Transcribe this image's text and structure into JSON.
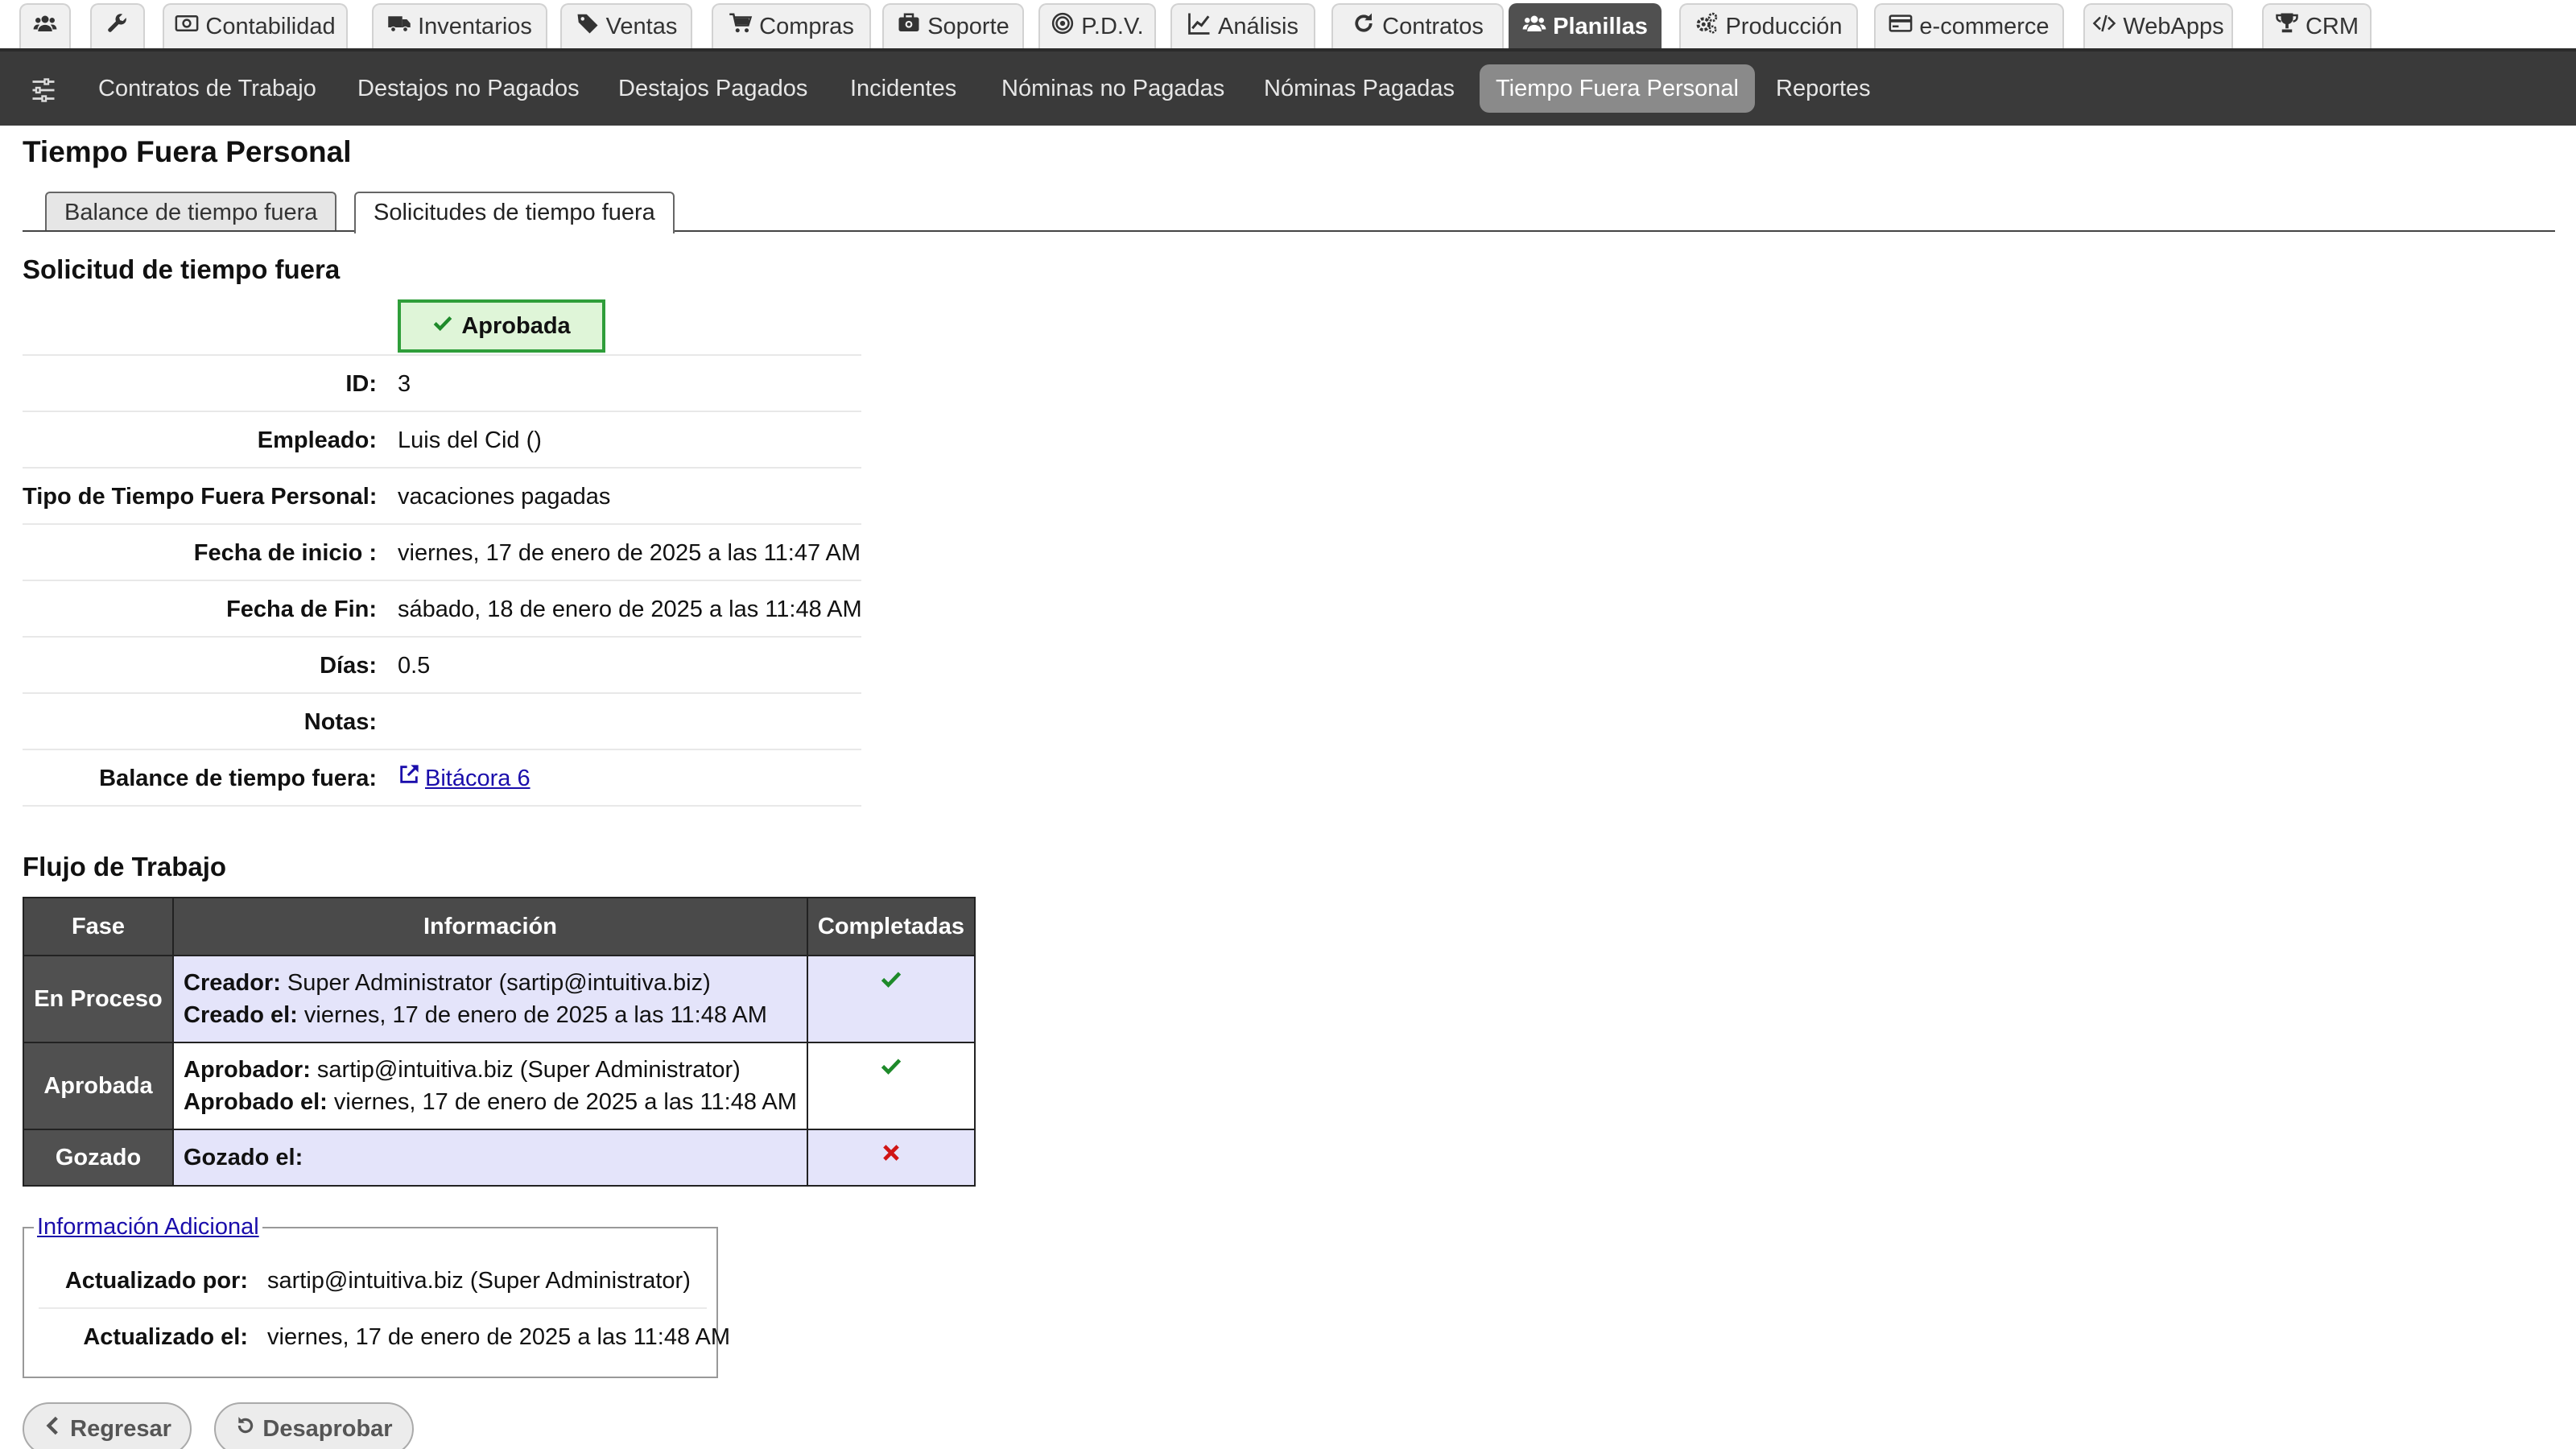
{
  "modules": [
    {
      "label": "",
      "icon": "users-icon"
    },
    {
      "label": "",
      "icon": "wrench-icon"
    },
    {
      "label": "Contabilidad",
      "icon": "money-icon"
    },
    {
      "label": "Inventarios",
      "icon": "truck-icon"
    },
    {
      "label": "Ventas",
      "icon": "tags-icon"
    },
    {
      "label": "Compras",
      "icon": "cart-icon"
    },
    {
      "label": "Soporte",
      "icon": "support-icon"
    },
    {
      "label": "P.D.V.",
      "icon": "target-icon"
    },
    {
      "label": "Análisis",
      "icon": "chart-icon"
    },
    {
      "label": "Contratos",
      "icon": "refresh-icon"
    },
    {
      "label": "Planillas",
      "icon": "users-icon",
      "active": true
    },
    {
      "label": "Producción",
      "icon": "cogs-icon"
    },
    {
      "label": "e-commerce",
      "icon": "card-icon"
    },
    {
      "label": "WebApps",
      "icon": "code-icon"
    },
    {
      "label": "CRM",
      "icon": "trophy-icon"
    }
  ],
  "subnav": [
    {
      "label": "Contratos de Trabajo"
    },
    {
      "label": "Destajos no Pagados"
    },
    {
      "label": "Destajos Pagados"
    },
    {
      "label": "Incidentes"
    },
    {
      "label": "Nóminas no Pagadas"
    },
    {
      "label": "Nóminas Pagadas"
    },
    {
      "label": "Tiempo Fuera Personal",
      "active": true
    },
    {
      "label": "Reportes"
    }
  ],
  "page": {
    "title": "Tiempo Fuera Personal",
    "tabs": [
      "Balance de tiempo fuera",
      "Solicitudes de tiempo fuera"
    ],
    "section_title": "Solicitud de tiempo fuera"
  },
  "request": {
    "status": "Aprobada",
    "fields": [
      {
        "label": "ID:",
        "value": "3"
      },
      {
        "label": "Empleado:",
        "value": "Luis del Cid ()"
      },
      {
        "label": "Tipo de Tiempo Fuera Personal:",
        "value": "vacaciones pagadas"
      },
      {
        "label": "Fecha de inicio :",
        "value": "viernes, 17 de enero de 2025 a las 11:47 AM"
      },
      {
        "label": "Fecha de Fin:",
        "value": "sábado, 18 de enero de 2025 a las 11:48 AM"
      },
      {
        "label": "Días:",
        "value": "0.5"
      },
      {
        "label": "Notas:",
        "value": ""
      },
      {
        "label": "Balance de tiempo fuera:",
        "value": " Bitácora 6",
        "link": true
      }
    ]
  },
  "workflow": {
    "title": "Flujo de Trabajo",
    "headers": [
      "Fase",
      "Información",
      "Completadas"
    ],
    "rows": [
      {
        "phase": "En Proceso",
        "lines": [
          {
            "k": "Creador:",
            "v": " Super Administrator (sartip@intuitiva.biz)"
          },
          {
            "k": "Creado el:",
            "v": " viernes, 17 de enero de 2025 a las 11:48 AM"
          }
        ],
        "done": true
      },
      {
        "phase": "Aprobada",
        "lines": [
          {
            "k": "Aprobador:",
            "v": " sartip@intuitiva.biz (Super Administrator)"
          },
          {
            "k": "Aprobado el:",
            "v": " viernes, 17 de enero de 2025 a las 11:48 AM"
          }
        ],
        "done": true
      },
      {
        "phase": "Gozado",
        "lines": [
          {
            "k": "Gozado el:",
            "v": ""
          }
        ],
        "done": false
      }
    ]
  },
  "additional": {
    "legend": "Información Adicional",
    "rows": [
      {
        "label": "Actualizado por:",
        "value": "sartip@intuitiva.biz (Super Administrator)"
      },
      {
        "label": "Actualizado el:",
        "value": "viernes, 17 de enero de 2025 a las 11:48 AM"
      }
    ]
  },
  "buttons": {
    "back": "Regresar",
    "disapprove": "Desaprobar"
  },
  "colors": {
    "approved_bg": "#dff5d8",
    "approved_border": "#2f9e3a",
    "check": "#1e8a2a",
    "cross": "#d01515",
    "row_shade": "#e4e4fa"
  }
}
